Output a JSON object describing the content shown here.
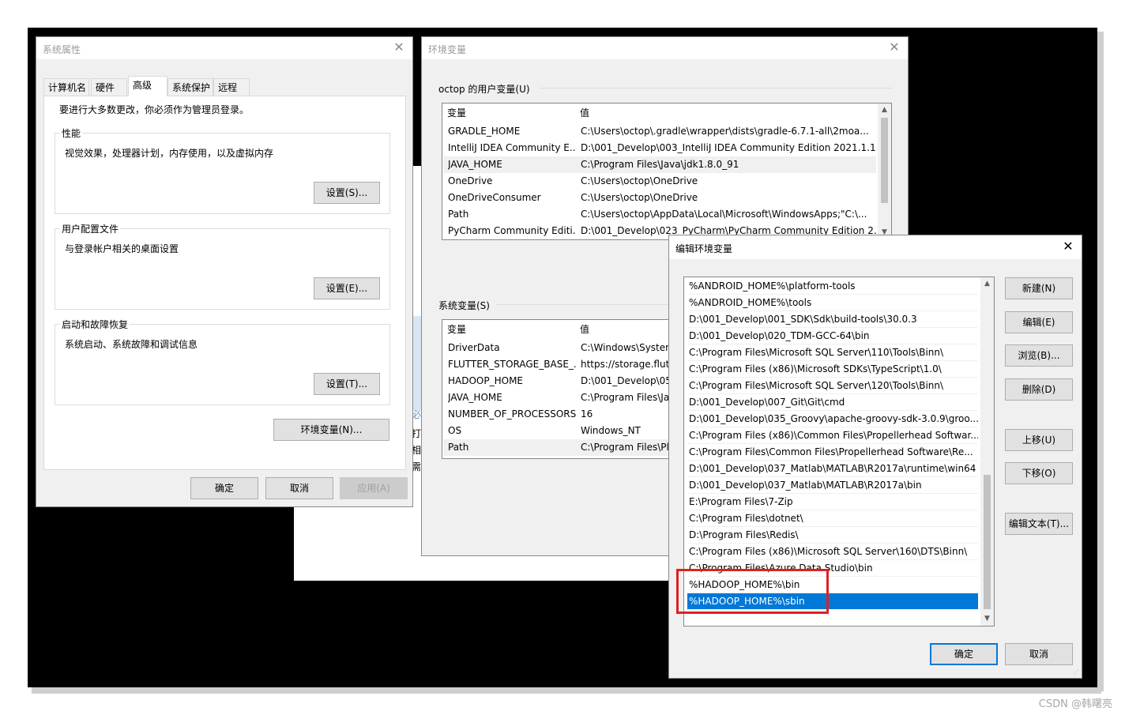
{
  "sysprops": {
    "title": "系统属性",
    "tabs": [
      "计算机名",
      "硬件",
      "高级",
      "系统保护",
      "远程"
    ],
    "admin_note": "要进行大多数更改，你必须作为管理员登录。",
    "performance": {
      "label": "性能",
      "desc": "视觉效果，处理器计划，内存使用，以及虚拟内存",
      "button": "设置(S)..."
    },
    "user_profiles": {
      "label": "用户配置文件",
      "desc": "与登录帐户相关的桌面设置",
      "button": "设置(E)..."
    },
    "startup": {
      "label": "启动和故障恢复",
      "desc": "系统启动、系统故障和调试信息",
      "button": "设置(T)..."
    },
    "env_button": "环境变量(N)...",
    "ok": "确定",
    "cancel": "取消",
    "apply": "应用(A)"
  },
  "envvars": {
    "title": "环境变量",
    "user_group_label": "octop 的用户变量(U)",
    "sys_group_label": "系统变量(S)",
    "col_name": "变量",
    "col_value": "值",
    "user_vars": [
      {
        "name": "GRADLE_HOME",
        "value": "C:\\Users\\octop\\.gradle\\wrapper\\dists\\gradle-6.7.1-all\\2moa..."
      },
      {
        "name": "IntelliJ IDEA Community E...",
        "value": "D:\\001_Develop\\003_IntelliJ IDEA Community Edition 2021.1.1..."
      },
      {
        "name": "JAVA_HOME",
        "value": "C:\\Program Files\\Java\\jdk1.8.0_91"
      },
      {
        "name": "OneDrive",
        "value": "C:\\Users\\octop\\OneDrive"
      },
      {
        "name": "OneDriveConsumer",
        "value": "C:\\Users\\octop\\OneDrive"
      },
      {
        "name": "Path",
        "value": "C:\\Users\\octop\\AppData\\Local\\Microsoft\\WindowsApps;\"C:\\..."
      },
      {
        "name": "PyCharm Community Editi...",
        "value": "D:\\001_Develop\\023_PyCharm\\PyCharm Community Edition 2..."
      }
    ],
    "sys_vars": [
      {
        "name": "DriverData",
        "value": "C:\\Windows\\System"
      },
      {
        "name": "FLUTTER_STORAGE_BASE_...",
        "value": "https://storage.flutt"
      },
      {
        "name": "HADOOP_HOME",
        "value": "D:\\001_Develop\\05"
      },
      {
        "name": "JAVA_HOME",
        "value": "C:\\Program Files\\Ja"
      },
      {
        "name": "NUMBER_OF_PROCESSORS",
        "value": "16"
      },
      {
        "name": "OS",
        "value": "Windows_NT"
      },
      {
        "name": "Path",
        "value": "C:\\Program Files\\Pl"
      }
    ]
  },
  "editenv": {
    "title": "编辑环境变量",
    "entries": [
      "%ANDROID_HOME%\\platform-tools",
      "%ANDROID_HOME%\\tools",
      "D:\\001_Develop\\001_SDK\\Sdk\\build-tools\\30.0.3",
      "D:\\001_Develop\\020_TDM-GCC-64\\bin",
      "C:\\Program Files\\Microsoft SQL Server\\110\\Tools\\Binn\\",
      "C:\\Program Files (x86)\\Microsoft SDKs\\TypeScript\\1.0\\",
      "C:\\Program Files\\Microsoft SQL Server\\120\\Tools\\Binn\\",
      "D:\\001_Develop\\007_Git\\Git\\cmd",
      "D:\\001_Develop\\035_Groovy\\apache-groovy-sdk-3.0.9\\groo...",
      "C:\\Program Files (x86)\\Common Files\\Propellerhead Softwar...",
      "C:\\Program Files\\Common Files\\Propellerhead Software\\Re...",
      "D:\\001_Develop\\037_Matlab\\MATLAB\\R2017a\\runtime\\win64",
      "D:\\001_Develop\\037_Matlab\\MATLAB\\R2017a\\bin",
      "E:\\Program Files\\7-Zip",
      "C:\\Program Files\\dotnet\\",
      "D:\\Program Files\\Redis\\",
      "C:\\Program Files (x86)\\Microsoft SQL Server\\160\\DTS\\Binn\\",
      "C:\\Program Files\\Azure Data Studio\\bin",
      "%HADOOP_HOME%\\bin",
      "%HADOOP_HOME%\\sbin"
    ],
    "selected_index": 19,
    "buttons": {
      "new": "新建(N)",
      "edit": "编辑(E)",
      "browse": "浏览(B)...",
      "delete": "删除(D)",
      "move_up": "上移(U)",
      "move_down": "下移(O)",
      "edit_text": "编辑文本(T)..."
    },
    "ok": "确定",
    "cancel": "取消"
  },
  "desktop_fragments": [
    "必",
    "打",
    "相",
    "需"
  ],
  "watermark": "CSDN @韩曙亮",
  "colors": {
    "selection": "#0078d7",
    "highlight_box": "#e02020"
  }
}
